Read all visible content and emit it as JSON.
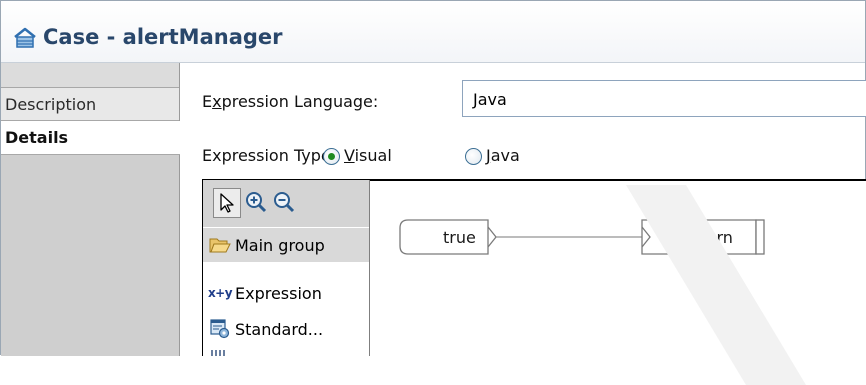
{
  "header": {
    "title": "Case - alertManager",
    "icon": "case-icon"
  },
  "tabs": [
    {
      "label": "Description",
      "selected": false
    },
    {
      "label": "Details",
      "selected": true
    }
  ],
  "expression_language": {
    "label_pre": "E",
    "label_mnemonic": "x",
    "label_post": "pression Language:",
    "value": "Java"
  },
  "expression_type": {
    "label": "Expression Type:",
    "options": [
      {
        "mnemonic": "V",
        "rest": "isual",
        "checked": true
      },
      {
        "mnemonic": "J",
        "rest": "ava",
        "checked": false
      }
    ]
  },
  "palette": {
    "tools": [
      "select-arrow-icon",
      "zoom-in-icon",
      "zoom-out-icon"
    ],
    "items": [
      {
        "label": "Main group",
        "icon": "folder-open-icon"
      },
      {
        "label": "Expression",
        "icon": "x+y"
      },
      {
        "label": "Standard...",
        "icon": "standard-function-icon"
      }
    ]
  },
  "canvas": {
    "nodes": [
      {
        "label": "true"
      },
      {
        "label": "return"
      }
    ]
  },
  "colors": {
    "title": "#29476b",
    "tab_area": "#cfcfcf",
    "radio_dot": "#1f8a1f",
    "field_border": "#8ea4bd"
  }
}
